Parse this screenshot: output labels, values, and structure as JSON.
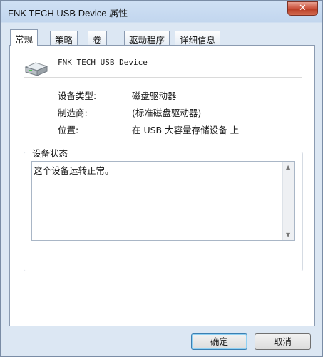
{
  "window": {
    "title": "FNK TECH USB Device 属性",
    "close_label": "✕"
  },
  "tabs": [
    {
      "label": "常规"
    },
    {
      "label": "策略"
    },
    {
      "label": "卷"
    },
    {
      "label": "驱动程序"
    },
    {
      "label": "详细信息"
    }
  ],
  "device": {
    "name": "FNK TECH USB Device",
    "icon": "drive-icon",
    "properties": [
      {
        "label": "设备类型:",
        "value": "磁盘驱动器"
      },
      {
        "label": "制造商:",
        "value": "(标准磁盘驱动器)"
      },
      {
        "label": "位置:",
        "value": "在 USB 大容量存储设备 上"
      }
    ]
  },
  "status": {
    "legend": "设备状态",
    "text": "这个设备运转正常。"
  },
  "buttons": {
    "ok": "确定",
    "cancel": "取消"
  }
}
